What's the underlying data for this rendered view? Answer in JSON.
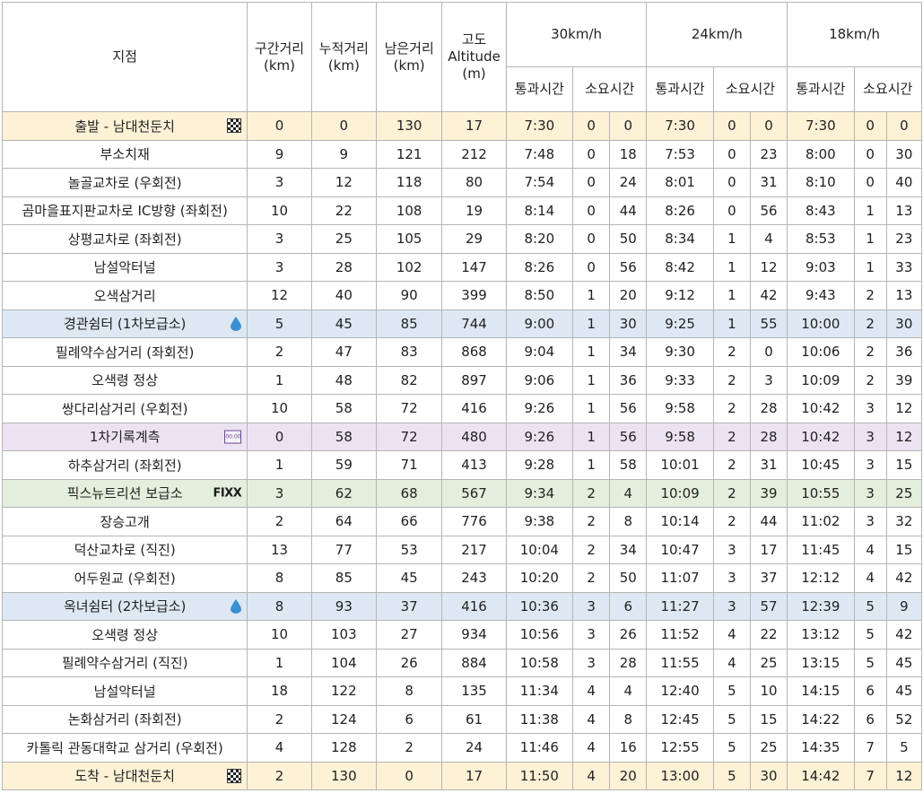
{
  "header": {
    "point": "지점",
    "segment": "구간거리\n(km)",
    "cumulative": "누적거리\n(km)",
    "remaining": "남은거리\n(km)",
    "altitude": "고도\nAltitude\n(m)",
    "speed1": "30km/h",
    "speed2": "24km/h",
    "speed3": "18km/h",
    "pass_time": "통과시간",
    "elapsed": "소요시간"
  },
  "icons": {
    "checkered_flag": "checkered-flag-icon",
    "water_drop": "water-drop-icon",
    "timer": "timer-icon",
    "sponsor_logo_text": "FIXX",
    "timer_text": "00:00"
  },
  "colors": {
    "start_finish_row": "#fdf1d6",
    "supply_row": "#dde8f3",
    "timing_row": "#ebe3f2",
    "sponsor_row": "#e3efdc",
    "water_drop": "#3b8fd3"
  },
  "rows": [
    {
      "name": "출발 - 남대천둔치",
      "type": "start",
      "icon": "flag",
      "seg": "0",
      "cum": "0",
      "rem": "130",
      "alt": "17",
      "t30": "7:30",
      "h30": "0",
      "m30": "0",
      "t24": "7:30",
      "h24": "0",
      "m24": "0",
      "t18": "7:30",
      "h18": "0",
      "m18": "0"
    },
    {
      "name": "부소치재",
      "type": "",
      "icon": "",
      "seg": "9",
      "cum": "9",
      "rem": "121",
      "alt": "212",
      "t30": "7:48",
      "h30": "0",
      "m30": "18",
      "t24": "7:53",
      "h24": "0",
      "m24": "23",
      "t18": "8:00",
      "h18": "0",
      "m18": "30"
    },
    {
      "name": "놀골교차로 (우회전)",
      "type": "",
      "icon": "",
      "seg": "3",
      "cum": "12",
      "rem": "118",
      "alt": "80",
      "t30": "7:54",
      "h30": "0",
      "m30": "24",
      "t24": "8:01",
      "h24": "0",
      "m24": "31",
      "t18": "8:10",
      "h18": "0",
      "m18": "40"
    },
    {
      "name": "곰마을표지판교차로 IC방향 (좌회전)",
      "type": "",
      "icon": "",
      "seg": "10",
      "cum": "22",
      "rem": "108",
      "alt": "19",
      "t30": "8:14",
      "h30": "0",
      "m30": "44",
      "t24": "8:26",
      "h24": "0",
      "m24": "56",
      "t18": "8:43",
      "h18": "1",
      "m18": "13"
    },
    {
      "name": "상평교차로 (좌회전)",
      "type": "",
      "icon": "",
      "seg": "3",
      "cum": "25",
      "rem": "105",
      "alt": "29",
      "t30": "8:20",
      "h30": "0",
      "m30": "50",
      "t24": "8:34",
      "h24": "1",
      "m24": "4",
      "t18": "8:53",
      "h18": "1",
      "m18": "23"
    },
    {
      "name": "남설악터널",
      "type": "",
      "icon": "",
      "seg": "3",
      "cum": "28",
      "rem": "102",
      "alt": "147",
      "t30": "8:26",
      "h30": "0",
      "m30": "56",
      "t24": "8:42",
      "h24": "1",
      "m24": "12",
      "t18": "9:03",
      "h18": "1",
      "m18": "33"
    },
    {
      "name": "오색삼거리",
      "type": "",
      "icon": "",
      "seg": "12",
      "cum": "40",
      "rem": "90",
      "alt": "399",
      "t30": "8:50",
      "h30": "1",
      "m30": "20",
      "t24": "9:12",
      "h24": "1",
      "m24": "42",
      "t18": "9:43",
      "h18": "2",
      "m18": "13"
    },
    {
      "name": "경관쉼터 (1차보급소)",
      "type": "supply",
      "icon": "drop",
      "seg": "5",
      "cum": "45",
      "rem": "85",
      "alt": "744",
      "t30": "9:00",
      "h30": "1",
      "m30": "30",
      "t24": "9:25",
      "h24": "1",
      "m24": "55",
      "t18": "10:00",
      "h18": "2",
      "m18": "30"
    },
    {
      "name": "필례약수삼거리 (좌회전)",
      "type": "",
      "icon": "",
      "seg": "2",
      "cum": "47",
      "rem": "83",
      "alt": "868",
      "t30": "9:04",
      "h30": "1",
      "m30": "34",
      "t24": "9:30",
      "h24": "2",
      "m24": "0",
      "t18": "10:06",
      "h18": "2",
      "m18": "36"
    },
    {
      "name": "오색령 정상",
      "type": "",
      "icon": "",
      "seg": "1",
      "cum": "48",
      "rem": "82",
      "alt": "897",
      "t30": "9:06",
      "h30": "1",
      "m30": "36",
      "t24": "9:33",
      "h24": "2",
      "m24": "3",
      "t18": "10:09",
      "h18": "2",
      "m18": "39"
    },
    {
      "name": "쌍다리삼거리 (우회전)",
      "type": "",
      "icon": "",
      "seg": "10",
      "cum": "58",
      "rem": "72",
      "alt": "416",
      "t30": "9:26",
      "h30": "1",
      "m30": "56",
      "t24": "9:58",
      "h24": "2",
      "m24": "28",
      "t18": "10:42",
      "h18": "3",
      "m18": "12"
    },
    {
      "name": "1차기록계측",
      "type": "timing",
      "icon": "timer",
      "seg": "0",
      "cum": "58",
      "rem": "72",
      "alt": "480",
      "t30": "9:26",
      "h30": "1",
      "m30": "56",
      "t24": "9:58",
      "h24": "2",
      "m24": "28",
      "t18": "10:42",
      "h18": "3",
      "m18": "12"
    },
    {
      "name": "하추삼거리 (좌회전)",
      "type": "",
      "icon": "",
      "seg": "1",
      "cum": "59",
      "rem": "71",
      "alt": "413",
      "t30": "9:28",
      "h30": "1",
      "m30": "58",
      "t24": "10:01",
      "h24": "2",
      "m24": "31",
      "t18": "10:45",
      "h18": "3",
      "m18": "15"
    },
    {
      "name": "픽스뉴트리션 보급소",
      "type": "sponsor",
      "icon": "fixx",
      "seg": "3",
      "cum": "62",
      "rem": "68",
      "alt": "567",
      "t30": "9:34",
      "h30": "2",
      "m30": "4",
      "t24": "10:09",
      "h24": "2",
      "m24": "39",
      "t18": "10:55",
      "h18": "3",
      "m18": "25"
    },
    {
      "name": "장승고개",
      "type": "",
      "icon": "",
      "seg": "2",
      "cum": "64",
      "rem": "66",
      "alt": "776",
      "t30": "9:38",
      "h30": "2",
      "m30": "8",
      "t24": "10:14",
      "h24": "2",
      "m24": "44",
      "t18": "11:02",
      "h18": "3",
      "m18": "32"
    },
    {
      "name": "덕산교차로 (직진)",
      "type": "",
      "icon": "",
      "seg": "13",
      "cum": "77",
      "rem": "53",
      "alt": "217",
      "t30": "10:04",
      "h30": "2",
      "m30": "34",
      "t24": "10:47",
      "h24": "3",
      "m24": "17",
      "t18": "11:45",
      "h18": "4",
      "m18": "15"
    },
    {
      "name": "어두원교 (우회전)",
      "type": "",
      "icon": "",
      "seg": "8",
      "cum": "85",
      "rem": "45",
      "alt": "243",
      "t30": "10:20",
      "h30": "2",
      "m30": "50",
      "t24": "11:07",
      "h24": "3",
      "m24": "37",
      "t18": "12:12",
      "h18": "4",
      "m18": "42"
    },
    {
      "name": "옥녀쉼터 (2차보급소)",
      "type": "supply",
      "icon": "drop",
      "seg": "8",
      "cum": "93",
      "rem": "37",
      "alt": "416",
      "t30": "10:36",
      "h30": "3",
      "m30": "6",
      "t24": "11:27",
      "h24": "3",
      "m24": "57",
      "t18": "12:39",
      "h18": "5",
      "m18": "9"
    },
    {
      "name": "오색령 정상",
      "type": "",
      "icon": "",
      "seg": "10",
      "cum": "103",
      "rem": "27",
      "alt": "934",
      "t30": "10:56",
      "h30": "3",
      "m30": "26",
      "t24": "11:52",
      "h24": "4",
      "m24": "22",
      "t18": "13:12",
      "h18": "5",
      "m18": "42"
    },
    {
      "name": "필례약수삼거리 (직진)",
      "type": "",
      "icon": "",
      "seg": "1",
      "cum": "104",
      "rem": "26",
      "alt": "884",
      "t30": "10:58",
      "h30": "3",
      "m30": "28",
      "t24": "11:55",
      "h24": "4",
      "m24": "25",
      "t18": "13:15",
      "h18": "5",
      "m18": "45"
    },
    {
      "name": "남설악터널",
      "type": "",
      "icon": "",
      "seg": "18",
      "cum": "122",
      "rem": "8",
      "alt": "135",
      "t30": "11:34",
      "h30": "4",
      "m30": "4",
      "t24": "12:40",
      "h24": "5",
      "m24": "10",
      "t18": "14:15",
      "h18": "6",
      "m18": "45"
    },
    {
      "name": "논화삼거리 (좌회전)",
      "type": "",
      "icon": "",
      "seg": "2",
      "cum": "124",
      "rem": "6",
      "alt": "61",
      "t30": "11:38",
      "h30": "4",
      "m30": "8",
      "t24": "12:45",
      "h24": "5",
      "m24": "15",
      "t18": "14:22",
      "h18": "6",
      "m18": "52"
    },
    {
      "name": "카톨릭 관동대학교 삼거리 (우회전)",
      "type": "",
      "icon": "",
      "seg": "4",
      "cum": "128",
      "rem": "2",
      "alt": "24",
      "t30": "11:46",
      "h30": "4",
      "m30": "16",
      "t24": "12:55",
      "h24": "5",
      "m24": "25",
      "t18": "14:35",
      "h18": "7",
      "m18": "5"
    },
    {
      "name": "도착 - 남대천둔치",
      "type": "finish",
      "icon": "flag",
      "seg": "2",
      "cum": "130",
      "rem": "0",
      "alt": "17",
      "t30": "11:50",
      "h30": "4",
      "m30": "20",
      "t24": "13:00",
      "h24": "5",
      "m24": "30",
      "t18": "14:42",
      "h18": "7",
      "m18": "12"
    }
  ]
}
